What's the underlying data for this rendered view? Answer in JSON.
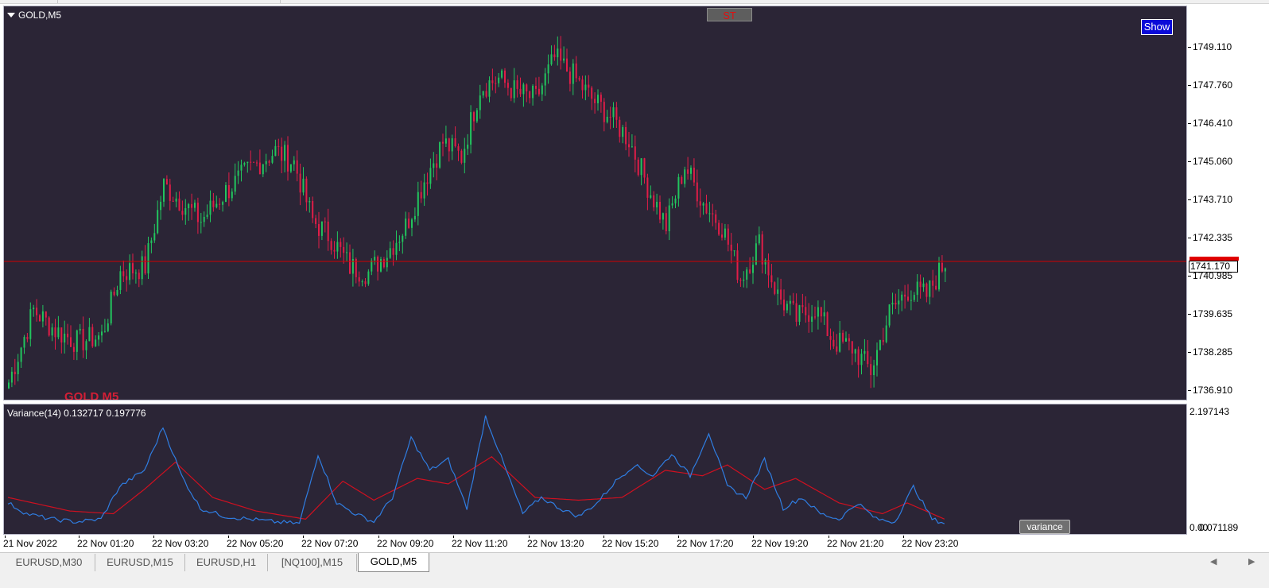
{
  "window": {
    "symbol_title": "GOLD,M5",
    "st_button": "ST",
    "show_button": "Show",
    "watermark": "GOLD M5"
  },
  "price_axis": {
    "labels": [
      "1749.110",
      "1747.760",
      "1746.410",
      "1745.060",
      "1743.710",
      "1742.335",
      "1740.985",
      "1739.635",
      "1738.285",
      "1736.910"
    ],
    "current_price": "1741.170"
  },
  "indicator": {
    "label": "Variance(14) 0.132717 0.197776",
    "axis_top": "2.197143",
    "axis_bottom_a": "0.00",
    "axis_bottom_b": "0.071189",
    "button": "variance"
  },
  "time_axis": {
    "labels": [
      "21 Nov 2022",
      "22 Nov 01:20",
      "22 Nov 03:20",
      "22 Nov 05:20",
      "22 Nov 07:20",
      "22 Nov 09:20",
      "22 Nov 11:20",
      "22 Nov 13:20",
      "22 Nov 15:20",
      "22 Nov 17:20",
      "22 Nov 19:20",
      "22 Nov 21:20",
      "22 Nov 23:20"
    ]
  },
  "tabs": [
    {
      "label": "EURUSD,M30",
      "active": false
    },
    {
      "label": "EURUSD,M15",
      "active": false
    },
    {
      "label": "EURUSD,H1",
      "active": false
    },
    {
      "label": "[NQ100],M15",
      "active": false
    },
    {
      "label": "GOLD,M5",
      "active": true
    }
  ],
  "colors": {
    "background": "#2b2536",
    "bull": "#22c55e",
    "bear": "#e11d48",
    "price_line": "#d10000",
    "variance_line": "#2f7de1",
    "signal_line": "#d01020"
  },
  "chart_data": {
    "type": "candlestick",
    "title": "GOLD,M5",
    "ylim": [
      1736.4,
      1750.0
    ],
    "current_price": 1741.17,
    "close_path": [
      {
        "i": 0,
        "price": 1737.0
      },
      {
        "i": 8,
        "price": 1739.5
      },
      {
        "i": 15,
        "price": 1738.8
      },
      {
        "i": 22,
        "price": 1738.4
      },
      {
        "i": 30,
        "price": 1738.6
      },
      {
        "i": 36,
        "price": 1740.8
      },
      {
        "i": 44,
        "price": 1741.0
      },
      {
        "i": 50,
        "price": 1743.8
      },
      {
        "i": 56,
        "price": 1743.2
      },
      {
        "i": 62,
        "price": 1742.6
      },
      {
        "i": 70,
        "price": 1743.6
      },
      {
        "i": 78,
        "price": 1744.4
      },
      {
        "i": 86,
        "price": 1745.0
      },
      {
        "i": 92,
        "price": 1744.6
      },
      {
        "i": 98,
        "price": 1742.6
      },
      {
        "i": 104,
        "price": 1742.0
      },
      {
        "i": 110,
        "price": 1741.0
      },
      {
        "i": 116,
        "price": 1740.8
      },
      {
        "i": 122,
        "price": 1741.5
      },
      {
        "i": 128,
        "price": 1742.4
      },
      {
        "i": 134,
        "price": 1744.0
      },
      {
        "i": 140,
        "price": 1745.3
      },
      {
        "i": 146,
        "price": 1744.8
      },
      {
        "i": 152,
        "price": 1747.2
      },
      {
        "i": 158,
        "price": 1747.5
      },
      {
        "i": 164,
        "price": 1747.0
      },
      {
        "i": 170,
        "price": 1746.8
      },
      {
        "i": 176,
        "price": 1748.2
      },
      {
        "i": 182,
        "price": 1747.6
      },
      {
        "i": 188,
        "price": 1746.8
      },
      {
        "i": 194,
        "price": 1746.2
      },
      {
        "i": 200,
        "price": 1745.4
      },
      {
        "i": 206,
        "price": 1743.8
      },
      {
        "i": 212,
        "price": 1742.4
      },
      {
        "i": 218,
        "price": 1744.5
      },
      {
        "i": 224,
        "price": 1743.2
      },
      {
        "i": 230,
        "price": 1742.4
      },
      {
        "i": 236,
        "price": 1740.6
      },
      {
        "i": 242,
        "price": 1741.8
      },
      {
        "i": 248,
        "price": 1740.0
      },
      {
        "i": 254,
        "price": 1739.2
      },
      {
        "i": 260,
        "price": 1739.6
      },
      {
        "i": 266,
        "price": 1738.4
      },
      {
        "i": 272,
        "price": 1738.2
      },
      {
        "i": 278,
        "price": 1737.4
      },
      {
        "i": 284,
        "price": 1739.4
      },
      {
        "i": 290,
        "price": 1740.2
      },
      {
        "i": 296,
        "price": 1740.0
      },
      {
        "i": 302,
        "price": 1741.17
      }
    ],
    "series": [
      {
        "name": "Variance(14)",
        "last": 0.132717
      },
      {
        "name": "signal",
        "last": 0.197776
      }
    ],
    "indicator_ylim": [
      0.0,
      2.197143
    ],
    "variance_path": [
      {
        "i": 0,
        "v": 0.5
      },
      {
        "i": 6,
        "v": 0.3
      },
      {
        "i": 14,
        "v": 0.2
      },
      {
        "i": 22,
        "v": 0.15
      },
      {
        "i": 30,
        "v": 0.2
      },
      {
        "i": 36,
        "v": 0.8
      },
      {
        "i": 44,
        "v": 1.1
      },
      {
        "i": 50,
        "v": 1.9
      },
      {
        "i": 56,
        "v": 1.0
      },
      {
        "i": 62,
        "v": 0.4
      },
      {
        "i": 70,
        "v": 0.25
      },
      {
        "i": 78,
        "v": 0.2
      },
      {
        "i": 86,
        "v": 0.15
      },
      {
        "i": 94,
        "v": 0.12
      },
      {
        "i": 100,
        "v": 1.4
      },
      {
        "i": 106,
        "v": 0.5
      },
      {
        "i": 112,
        "v": 0.3
      },
      {
        "i": 118,
        "v": 0.15
      },
      {
        "i": 124,
        "v": 0.6
      },
      {
        "i": 130,
        "v": 1.7
      },
      {
        "i": 136,
        "v": 1.1
      },
      {
        "i": 142,
        "v": 1.3
      },
      {
        "i": 148,
        "v": 0.4
      },
      {
        "i": 154,
        "v": 2.1
      },
      {
        "i": 160,
        "v": 1.2
      },
      {
        "i": 166,
        "v": 0.3
      },
      {
        "i": 172,
        "v": 0.6
      },
      {
        "i": 178,
        "v": 0.4
      },
      {
        "i": 184,
        "v": 0.25
      },
      {
        "i": 190,
        "v": 0.5
      },
      {
        "i": 196,
        "v": 0.9
      },
      {
        "i": 202,
        "v": 1.2
      },
      {
        "i": 208,
        "v": 1.0
      },
      {
        "i": 214,
        "v": 1.4
      },
      {
        "i": 220,
        "v": 1.0
      },
      {
        "i": 226,
        "v": 1.8
      },
      {
        "i": 232,
        "v": 0.8
      },
      {
        "i": 238,
        "v": 0.6
      },
      {
        "i": 244,
        "v": 1.3
      },
      {
        "i": 250,
        "v": 0.4
      },
      {
        "i": 256,
        "v": 0.6
      },
      {
        "i": 262,
        "v": 0.3
      },
      {
        "i": 268,
        "v": 0.2
      },
      {
        "i": 274,
        "v": 0.5
      },
      {
        "i": 280,
        "v": 0.2
      },
      {
        "i": 286,
        "v": 0.15
      },
      {
        "i": 292,
        "v": 0.8
      },
      {
        "i": 298,
        "v": 0.2
      },
      {
        "i": 302,
        "v": 0.13
      }
    ],
    "signal_path": [
      {
        "i": 0,
        "v": 0.6
      },
      {
        "i": 20,
        "v": 0.35
      },
      {
        "i": 34,
        "v": 0.3
      },
      {
        "i": 44,
        "v": 0.75
      },
      {
        "i": 54,
        "v": 1.25
      },
      {
        "i": 66,
        "v": 0.6
      },
      {
        "i": 80,
        "v": 0.35
      },
      {
        "i": 96,
        "v": 0.2
      },
      {
        "i": 108,
        "v": 0.9
      },
      {
        "i": 118,
        "v": 0.55
      },
      {
        "i": 132,
        "v": 0.95
      },
      {
        "i": 142,
        "v": 0.85
      },
      {
        "i": 156,
        "v": 1.35
      },
      {
        "i": 170,
        "v": 0.6
      },
      {
        "i": 184,
        "v": 0.55
      },
      {
        "i": 198,
        "v": 0.6
      },
      {
        "i": 212,
        "v": 1.1
      },
      {
        "i": 224,
        "v": 1.0
      },
      {
        "i": 232,
        "v": 1.2
      },
      {
        "i": 244,
        "v": 0.75
      },
      {
        "i": 254,
        "v": 0.95
      },
      {
        "i": 268,
        "v": 0.5
      },
      {
        "i": 282,
        "v": 0.3
      },
      {
        "i": 290,
        "v": 0.5
      },
      {
        "i": 302,
        "v": 0.2
      }
    ]
  }
}
